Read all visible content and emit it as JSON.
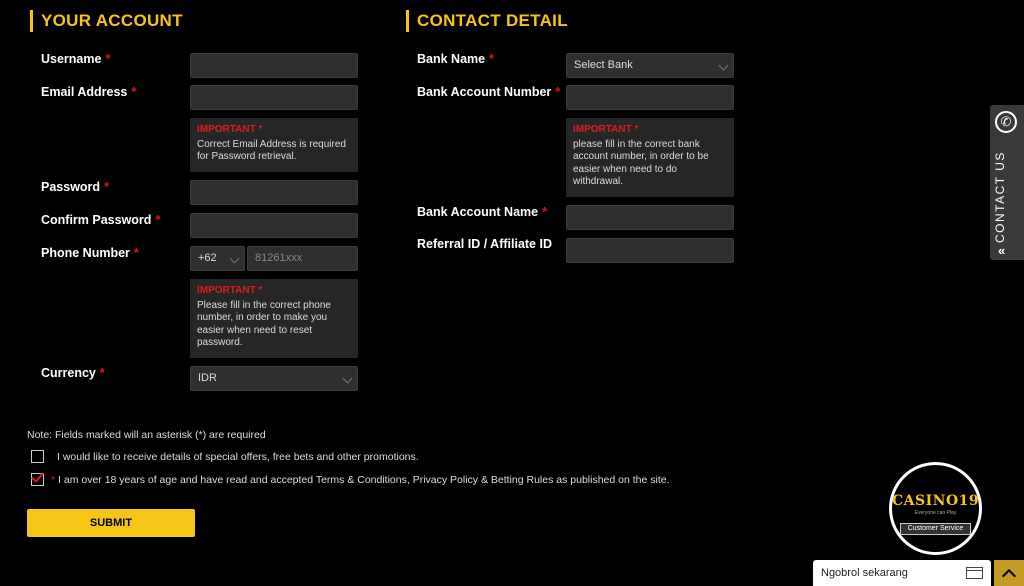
{
  "account": {
    "title": "YOUR ACCOUNT",
    "username_label": "Username",
    "email_label": "Email Address",
    "email_note_title": "IMPORTANT *",
    "email_note_text": "Correct Email Address is required for Password retrieval.",
    "password_label": "Password",
    "confirm_password_label": "Confirm Password",
    "phone_label": "Phone Number",
    "phone_code": "+62",
    "phone_placeholder": "81261xxx",
    "phone_note_title": "IMPORTANT *",
    "phone_note_text": "Please fill in the correct phone number, in order to make you easier when need to reset password.",
    "currency_label": "Currency",
    "currency_value": "IDR"
  },
  "contact": {
    "title": "CONTACT DETAIL",
    "bank_name_label": "Bank Name",
    "bank_select_value": "Select Bank",
    "bank_account_number_label": "Bank Account Number",
    "bank_note_title": "IMPORTANT *",
    "bank_note_text": "please fill in the correct bank account number, in order to be easier when need to do withdrawal.",
    "bank_account_name_label": "Bank Account Name",
    "referral_label": "Referral ID / Affiliate ID"
  },
  "form": {
    "required_marker": "*",
    "note": "Note: Fields marked will an asterisk (*) are required",
    "promo_checkbox_label": "I would like to receive details of special offers, free bets and other promotions.",
    "terms_checkbox_label": "I am over 18 years of age and have read and accepted Terms & Conditions, Privacy Policy & Betting Rules as published on the site.",
    "submit_label": "SUBMIT"
  },
  "widgets": {
    "contact_us_label": "CONTACT US",
    "logo_text": "CASINO198",
    "logo_tagline": "Everyone can Play",
    "customer_service_label": "Customer Service",
    "chat_label": "Ngobrol sekarang"
  },
  "colors": {
    "accent": "#f5c518",
    "required": "#e0191d",
    "background": "#000000",
    "input_bg": "#2f2f2f"
  },
  "icons": {
    "phone": "phone-icon",
    "chevron": "chevron-down-icon",
    "double_chevron": "double-chevron-left-icon",
    "chat_window": "chat-window-icon",
    "scroll_top": "chevron-up-icon"
  }
}
